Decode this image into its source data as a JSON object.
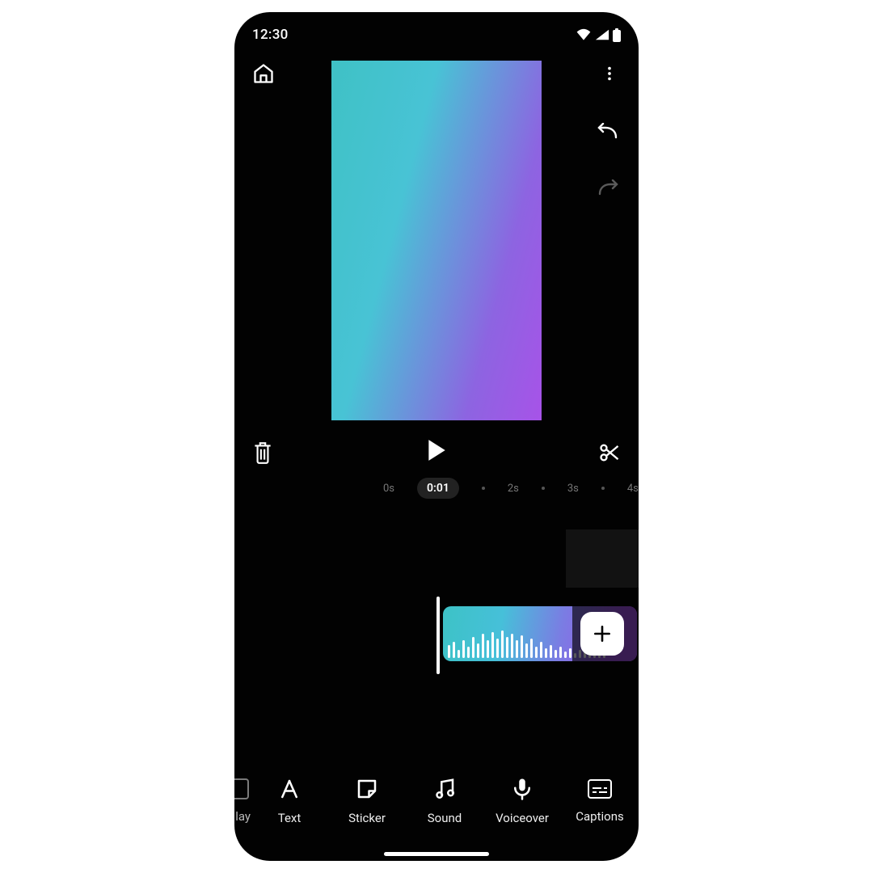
{
  "status": {
    "time": "12:30"
  },
  "ruler": {
    "labels": [
      "0s",
      "2s",
      "3s",
      "4s"
    ],
    "current_time": "0:01"
  },
  "toolbar": {
    "partial_label": "lay",
    "items": [
      {
        "label": "Text",
        "icon": "text-icon"
      },
      {
        "label": "Sticker",
        "icon": "sticker-icon"
      },
      {
        "label": "Sound",
        "icon": "music-icon"
      },
      {
        "label": "Voiceover",
        "icon": "mic-icon"
      },
      {
        "label": "Captions",
        "icon": "captions-icon"
      }
    ]
  },
  "preview": {
    "gradient_from": "#3fc1c5",
    "gradient_to": "#a753e8"
  },
  "clip": {
    "waveform_heights": [
      16,
      20,
      10,
      22,
      14,
      26,
      18,
      30,
      22,
      32,
      24,
      34,
      26,
      30,
      22,
      28,
      18,
      24,
      14,
      20,
      12,
      16,
      10,
      14,
      8,
      12,
      6,
      10,
      8,
      12,
      10,
      14,
      10
    ]
  }
}
